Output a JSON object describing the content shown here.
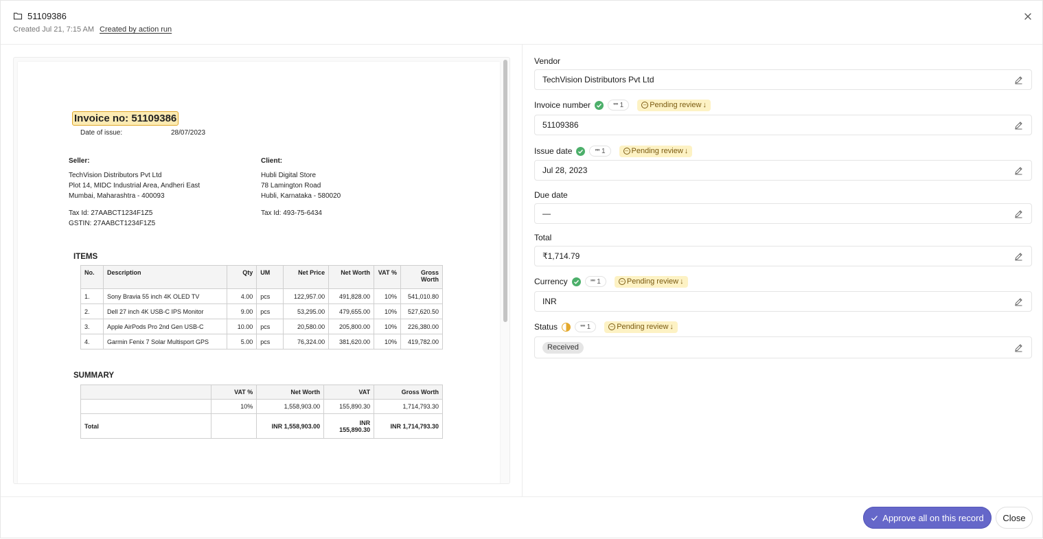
{
  "header": {
    "title": "51109386",
    "created": "Created Jul 21, 7:15 AM",
    "created_by": "Created by action run",
    "folder_icon": "folder-icon",
    "close_icon": "close-icon"
  },
  "document": {
    "invoice_title": "Invoice no: 51109386",
    "date_of_issue_label": "Date of issue:",
    "date_of_issue": "28/07/2023",
    "seller_label": "Seller:",
    "seller_lines": [
      "TechVision Distributors Pvt Ltd",
      "Plot 14, MIDC Industrial Area, Andheri East",
      "Mumbai, Maharashtra - 400093"
    ],
    "seller_tax": [
      "Tax Id: 27AABCT1234F1Z5",
      "GSTIN: 27AABCT1234F1Z5"
    ],
    "client_label": "Client:",
    "client_lines": [
      "Hubli Digital Store",
      "78 Lamington Road",
      "Hubli, Karnataka - 580020"
    ],
    "client_tax": "Tax Id: 493-75-6434",
    "items_heading": "ITEMS",
    "items_headers": [
      "No.",
      "Description",
      "Qty",
      "UM",
      "Net Price",
      "Net Worth",
      "VAT %",
      "Gross Worth"
    ],
    "items": [
      [
        "1.",
        "Sony Bravia 55 inch 4K OLED TV",
        "4.00",
        "pcs",
        "122,957.00",
        "491,828.00",
        "10%",
        "541,010.80"
      ],
      [
        "2.",
        "Dell 27 inch 4K USB-C IPS Monitor",
        "9.00",
        "pcs",
        "53,295.00",
        "479,655.00",
        "10%",
        "527,620.50"
      ],
      [
        "3.",
        "Apple AirPods Pro 2nd Gen USB-C",
        "10.00",
        "pcs",
        "20,580.00",
        "205,800.00",
        "10%",
        "226,380.00"
      ],
      [
        "4.",
        "Garmin Fenix 7 Solar Multisport GPS",
        "5.00",
        "pcs",
        "76,324.00",
        "381,620.00",
        "10%",
        "419,782.00"
      ]
    ],
    "summary_heading": "SUMMARY",
    "summary_headers": [
      "",
      "VAT %",
      "Net Worth",
      "VAT",
      "Gross Worth"
    ],
    "summary_row": [
      "",
      "10%",
      "1,558,903.00",
      "155,890.30",
      "1,714,793.30"
    ],
    "summary_total": [
      "Total",
      "",
      "INR 1,558,903.00",
      "INR 155,890.30",
      "INR 1,714,793.30"
    ]
  },
  "fields": {
    "vendor": {
      "label": "Vendor",
      "value": "TechVision Distributors Pvt Ltd"
    },
    "invoice_number": {
      "label": "Invoice number",
      "value": "51109386",
      "cite_count": "1",
      "pending": "Pending review"
    },
    "issue_date": {
      "label": "Issue date",
      "value": "Jul 28, 2023",
      "cite_count": "1",
      "pending": "Pending review"
    },
    "due_date": {
      "label": "Due date",
      "value": "—"
    },
    "total": {
      "label": "Total",
      "value": "₹1,714.79"
    },
    "currency": {
      "label": "Currency",
      "value": "INR",
      "cite_count": "1",
      "pending": "Pending review"
    },
    "status": {
      "label": "Status",
      "value": "Received",
      "cite_count": "1",
      "pending": "Pending review"
    }
  },
  "footer": {
    "approve_label": "Approve all on this record",
    "close_label": "Close"
  },
  "colors": {
    "accent": "#6567c9",
    "pending_bg": "#fdf2c4",
    "pending_text": "#7a5a10",
    "check_green": "#4caf6a",
    "highlight": "#fcebb3"
  }
}
